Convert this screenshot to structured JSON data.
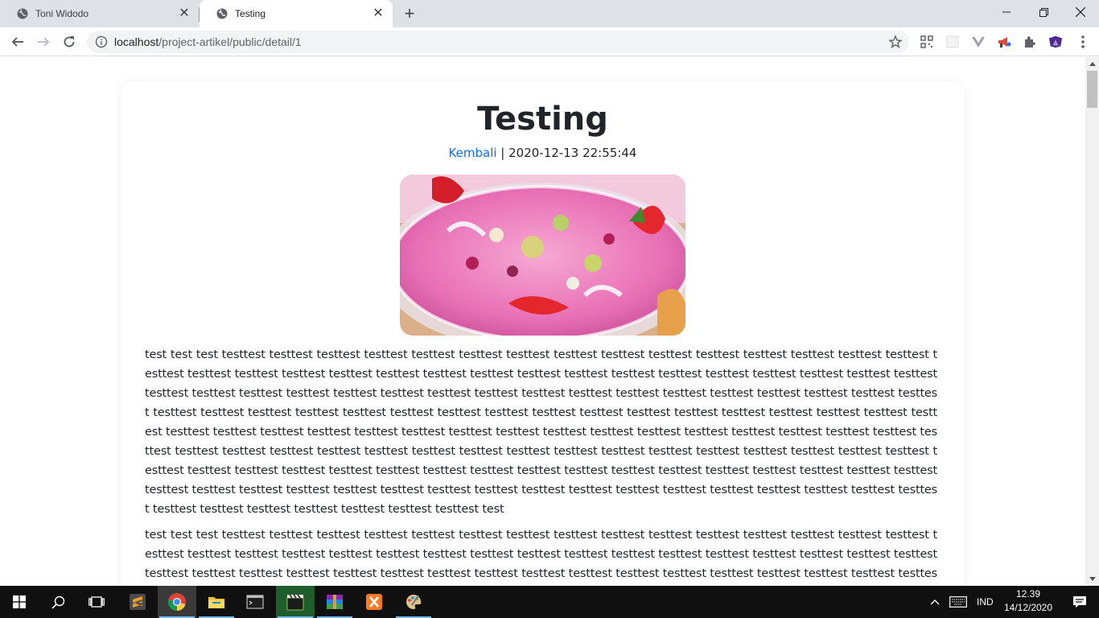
{
  "browser": {
    "tabs": [
      {
        "title": "Toni Widodo",
        "active": false
      },
      {
        "title": "Testing",
        "active": true
      }
    ],
    "url": {
      "host": "localhost",
      "path": "/project-artikel/public/detail/1"
    }
  },
  "article": {
    "title": "Testing",
    "back_link": "Kembali",
    "separator": " | ",
    "datetime": "2020-12-13 22:55:44",
    "paragraphs": [
      "test test test testtest testtest testtest testtest testtest testtest testtest testtest testtest testtest testtest testtest testtest testtest testtest testtest testtest testtest testtest testtest testtest testtest testtest testtest testtest testtest testtest testtest testtest testtest testtest testtest testtest testtest testtest testtest testtest testtest testtest testtest testtest testtest testtest testtest testtest testtest testtest testtest testtest testtest testtest testtest testtest testtest testtest testtest testtest testtest testtest testtest testtest testtest testtest testtest testtest testtest testtest testtest testtest testtest testtest testtest testtest testtest testtest testtest testtest testtest testtest testtest testtest testtest testtest testtest testtest testtest testtest testtest testtest testtest testtest testtest testtest testtest testtest testtest testtest testtest testtest testtest testtest testtest testtest testtest testtest testtest testtest testtest testtest testtest testtest testtest testtest testtest testtest testtest testtest testtest testtest testtest testtest testtest testtest testtest testtest testtest testtest testtest testtest testtest testtest testtest testtest testtest testtest testtest testtest testtest testtest testtest test",
      "test test test testtest testtest testtest testtest testtest testtest testtest testtest testtest testtest testtest testtest testtest testtest testtest testtest testtest testtest testtest testtest testtest testtest testtest testtest testtest testtest testtest testtest testtest testtest testtest testtest testtest testtest testtest testtest testtest testtest testtest testtest testtest testtest testtest testtest testtest testtest testtest testtest testtest testtest testtest testtest testtest testtest testtest testtest testtest testtest"
    ]
  },
  "taskbar": {
    "language": "IND",
    "time": "12.39",
    "date": "14/12/2020"
  },
  "colors": {
    "link": "#0d6efd",
    "tabstrip": "#dee1e6",
    "taskbar": "#101010"
  }
}
